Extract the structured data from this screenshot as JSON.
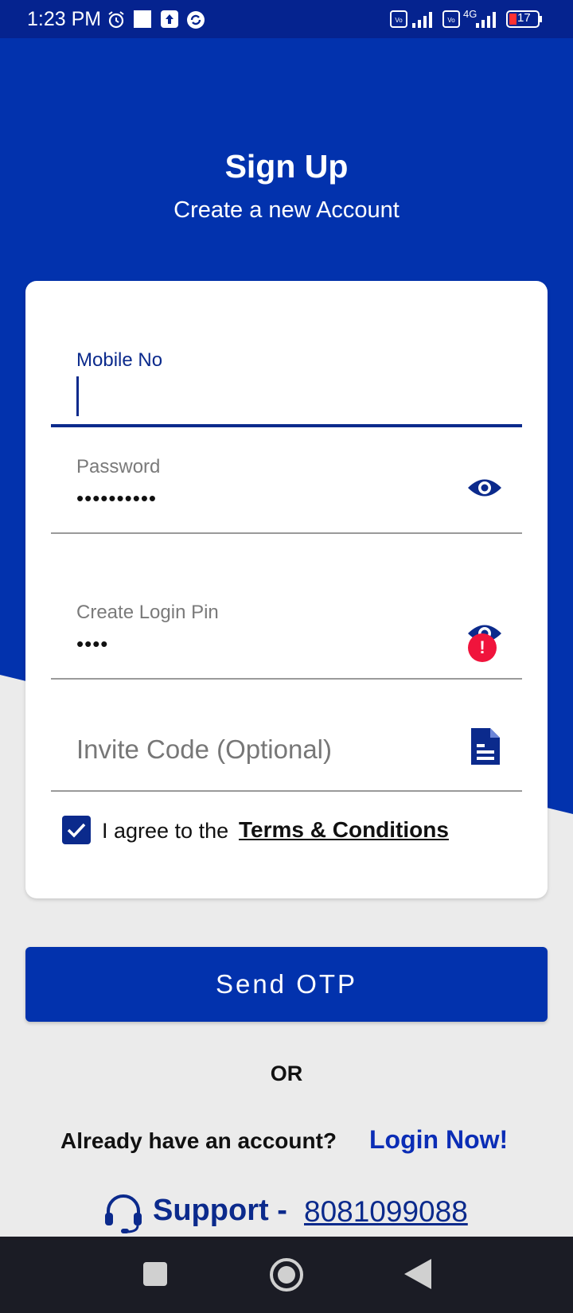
{
  "status_bar": {
    "time": "1:23 PM",
    "network": "4G",
    "battery": "17"
  },
  "header": {
    "title": "Sign Up",
    "subtitle": "Create a new Account"
  },
  "form": {
    "mobile": {
      "label": "Mobile No",
      "value": ""
    },
    "password": {
      "label": "Password",
      "value": "••••••••••"
    },
    "pin": {
      "label": "Create Login Pin",
      "value": "••••",
      "warning": "!"
    },
    "invite": {
      "placeholder": "Invite Code (Optional)"
    },
    "agree": {
      "text": "I agree to the",
      "link": "Terms & Conditions",
      "checked": true
    }
  },
  "actions": {
    "send_otp": "Send OTP",
    "or": "OR",
    "already": "Already have an account?",
    "login": "Login Now!"
  },
  "support": {
    "label": "Support -",
    "number": "8081099088"
  },
  "colors": {
    "primary": "#0232ad",
    "dark_blue": "#0b2a8c",
    "warning": "#f0143c",
    "background": "#ebebeb"
  },
  "icons": [
    "alarm-icon",
    "upload-icon",
    "signal-icon",
    "battery-icon",
    "eye-icon",
    "document-icon",
    "checkmark-icon",
    "headset-icon",
    "nav-square-icon",
    "nav-circle-icon",
    "nav-back-icon"
  ]
}
